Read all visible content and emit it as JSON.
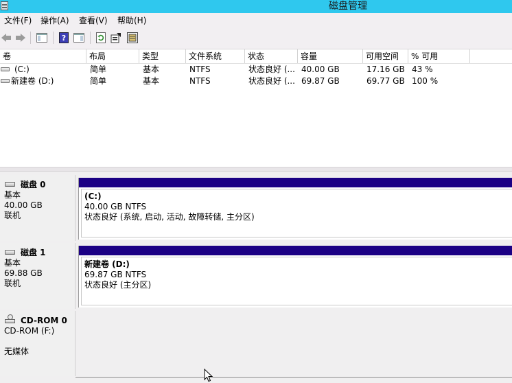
{
  "window": {
    "title": "磁盘管理"
  },
  "menu": [
    {
      "label": "文件(F)"
    },
    {
      "label": "操作(A)"
    },
    {
      "label": "查看(V)"
    },
    {
      "label": "帮助(H)"
    }
  ],
  "toolbar": {
    "icons": [
      "back-icon",
      "forward-icon",
      "console-tree-icon",
      "help-icon",
      "action-pane-icon",
      "refresh-icon",
      "properties-icon",
      "disk-rescan-icon"
    ]
  },
  "volume_list": {
    "columns": [
      "卷",
      "布局",
      "类型",
      "文件系统",
      "状态",
      "容量",
      "可用空间",
      "% 可用"
    ],
    "rows": [
      [
        "(C:)",
        "简单",
        "基本",
        "NTFS",
        "状态良好 (...",
        "40.00 GB",
        "17.16 GB",
        "43 %"
      ],
      [
        "新建卷 (D:)",
        "简单",
        "基本",
        "NTFS",
        "状态良好 (...",
        "69.87 GB",
        "69.77 GB",
        "100 %"
      ]
    ]
  },
  "disks": [
    {
      "name": "磁盘 0",
      "type": "基本",
      "size": "40.00 GB",
      "status": "联机",
      "partition": {
        "label": "(C:)",
        "size_fs": "40.00 GB NTFS",
        "status": "状态良好 (系统, 启动, 活动, 故障转储, 主分区)"
      }
    },
    {
      "name": "磁盘 1",
      "type": "基本",
      "size": "69.88 GB",
      "status": "联机",
      "partition": {
        "label": "新建卷  (D:)",
        "size_fs": "69.87 GB NTFS",
        "status": "状态良好 (主分区)"
      }
    }
  ],
  "cdrom": {
    "name": "CD-ROM 0",
    "drive": "CD-ROM (F:)",
    "status": "无媒体"
  },
  "colors": {
    "titlebar": "#2fc8ee",
    "partition_bar": "#1b0084",
    "menu_bg": "#f2eff2"
  }
}
